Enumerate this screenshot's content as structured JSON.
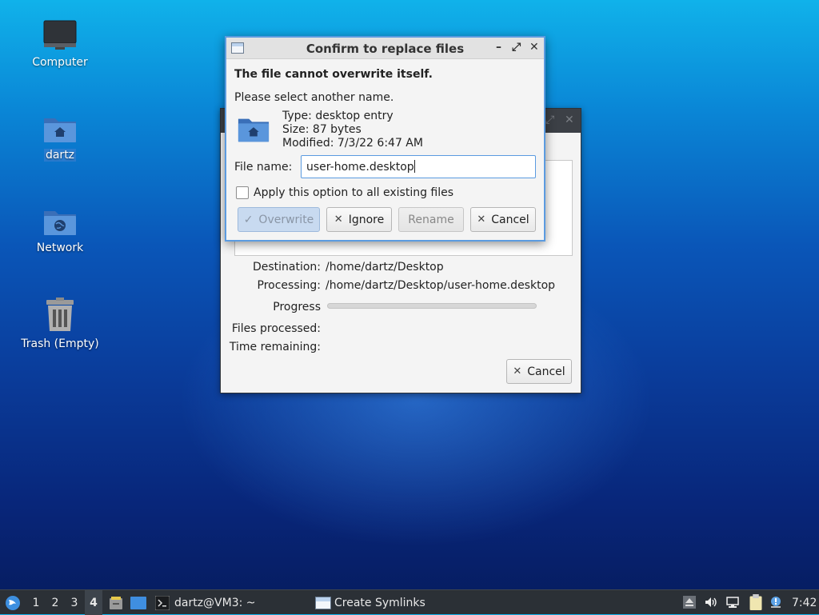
{
  "desktop": {
    "icons": [
      {
        "label": "Computer",
        "icon": "computer-icon"
      },
      {
        "label": "dartz",
        "icon": "home-folder-icon"
      },
      {
        "label": "Network",
        "icon": "network-folder-icon"
      },
      {
        "label": "Trash (Empty)",
        "icon": "trash-icon"
      }
    ]
  },
  "progress_window": {
    "destination_label": "Destination:",
    "destination_value": "/home/dartz/Desktop",
    "processing_label": "Processing:",
    "processing_value": "/home/dartz/Desktop/user-home.desktop",
    "progress_label": "Progress",
    "progress_fraction": 0.0,
    "files_processed_label": "Files processed:",
    "time_remaining_label": "Time remaining:",
    "cancel_label": "Cancel"
  },
  "dialog": {
    "title": "Confirm to replace files",
    "heading": "The file cannot overwrite itself.",
    "instruction": "Please select another name.",
    "type_line": "Type: desktop entry",
    "size_line": "Size: 87 bytes",
    "modified_line": "Modified: 7/3/22 6:47 AM",
    "file_name_label": "File name:",
    "file_name_value": "user-home.desktop",
    "apply_all_label": "Apply this option to all existing files",
    "apply_all_checked": false,
    "buttons": {
      "overwrite": "Overwrite",
      "ignore": "Ignore",
      "rename": "Rename",
      "cancel": "Cancel"
    }
  },
  "taskbar": {
    "workspaces": [
      "1",
      "2",
      "3",
      "4"
    ],
    "active_workspace": "4",
    "terminal_task": "dartz@VM3: ~",
    "active_task": "Create Symlinks",
    "clock": "7:42"
  },
  "colors": {
    "accent": "#5b9be0",
    "folder_blue": "#4a86d4",
    "taskbar": "#2b3036"
  }
}
